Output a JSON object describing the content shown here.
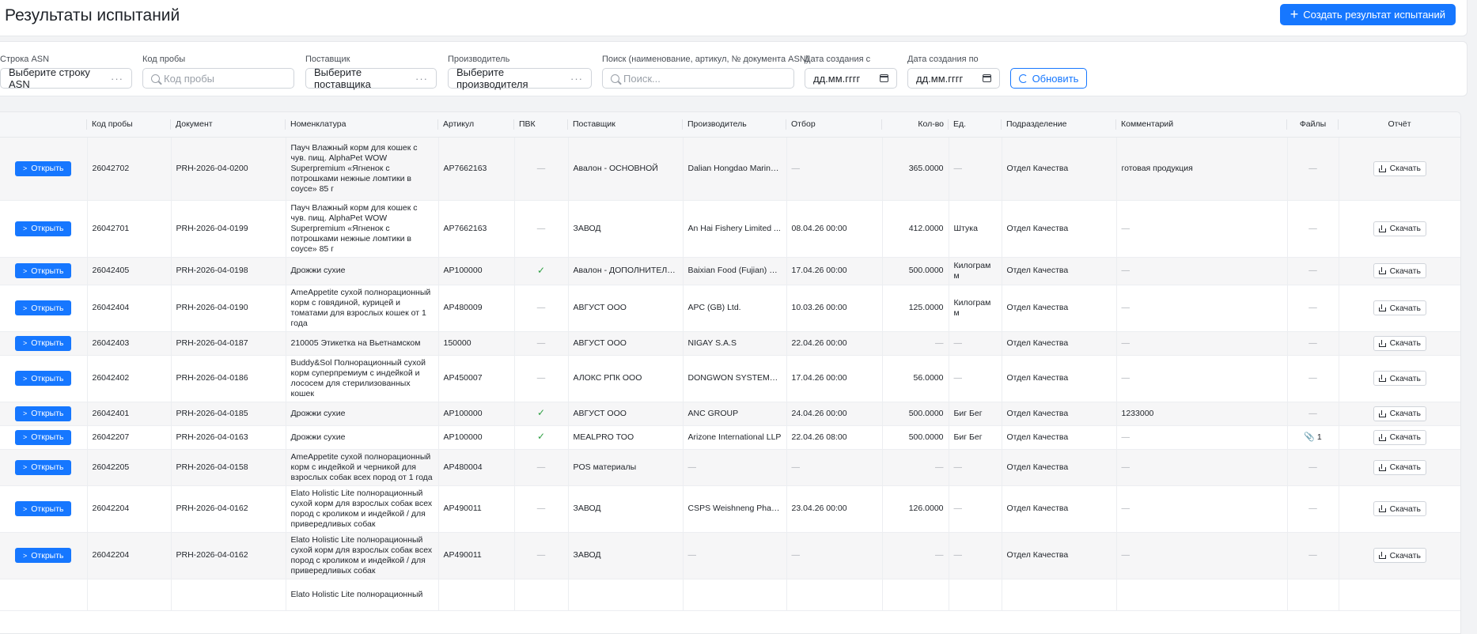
{
  "header": {
    "title": "Результаты испытаний",
    "create_button": "Создать результат испытаний"
  },
  "filters": {
    "asn": {
      "label": "Строка ASN",
      "value": "Выберите строку ASN"
    },
    "sample": {
      "label": "Код пробы",
      "placeholder": "Код пробы"
    },
    "supplier": {
      "label": "Поставщик",
      "value": "Выберите поставщика"
    },
    "manufacturer": {
      "label": "Производитель",
      "value": "Выберите производителя"
    },
    "search": {
      "label": "Поиск (наименование, артикул, № документа ASN)",
      "placeholder": "Поиск..."
    },
    "date_from": {
      "label": "Дата создания с",
      "value": "дд.мм.гггг"
    },
    "date_to": {
      "label": "Дата создания по",
      "value": "дд.мм.гггг"
    },
    "refresh_button": "Обновить"
  },
  "table": {
    "columns": [
      "",
      "Код пробы",
      "Документ",
      "Номенклатура",
      "Артикул",
      "ПВК",
      "Поставщик",
      "Производитель",
      "Отбор",
      "Кол-во",
      "Ед.",
      "Подразделение",
      "Комментарий",
      "Файлы",
      "Отчёт"
    ],
    "open_label": "Открыть",
    "download_label": "Скачать",
    "dash": "—",
    "check": "✓",
    "rows": [
      {
        "code": "26042702",
        "doc": "PRH-2026-04-0200",
        "name": "Пауч Влажный корм для кошек с чув. пищ. AlphaPet WOW Superpremium «Ягненок с потрошками нежные ломтики в соусе» 85 г",
        "article": "AP7662163",
        "pvk": "—",
        "supplier": "Авалон - ОСНОВНОЙ",
        "manufacturer": "Dalian Hongdao Marine...",
        "selection": "—",
        "qty": "365.0000",
        "unit": "—",
        "dept": "Отдел Качества",
        "comment": "готовая продукция",
        "files": "—"
      },
      {
        "code": "26042701",
        "doc": "PRH-2026-04-0199",
        "name": "Пауч Влажный корм для кошек с чув. пищ. AlphaPet WOW Superpremium «Ягненок с потрошками нежные ломтики в соусе» 85 г",
        "article": "AP7662163",
        "pvk": "—",
        "supplier": "ЗАВОД",
        "manufacturer": "An Hai Fishery Limited ...",
        "selection": "08.04.26 00:00",
        "qty": "412.0000",
        "unit": "Штука",
        "dept": "Отдел Качества",
        "comment": "—",
        "files": "—"
      },
      {
        "code": "26042405",
        "doc": "PRH-2026-04-0198",
        "name": "Дрожжи сухие",
        "article": "AP100000",
        "pvk": "✓",
        "supplier": "Авалон - ДОПОЛНИТЕЛЬ...",
        "manufacturer": "Baixian Food (Fujian) Co...",
        "selection": "17.04.26 00:00",
        "qty": "500.0000",
        "unit": "Килограм м",
        "dept": "Отдел Качества",
        "comment": "—",
        "files": "—"
      },
      {
        "code": "26042404",
        "doc": "PRH-2026-04-0190",
        "name": "AmeAppetite сухой полнорационный корм с говядиной, курицей и томатами для взрослых кошек от 1 года",
        "article": "AP480009",
        "pvk": "—",
        "supplier": "АВГУСТ ООО",
        "manufacturer": "APC (GB) Ltd.",
        "selection": "10.03.26 00:00",
        "qty": "125.0000",
        "unit": "Килограм м",
        "dept": "Отдел Качества",
        "comment": "—",
        "files": "—"
      },
      {
        "code": "26042403",
        "doc": "PRH-2026-04-0187",
        "name": "210005 Этикетка на Вьетнамском",
        "article": "150000",
        "pvk": "—",
        "supplier": "АВГУСТ ООО",
        "manufacturer": "NIGAY S.A.S",
        "selection": "22.04.26 00:00",
        "qty": "—",
        "unit": "—",
        "dept": "Отдел Качества",
        "comment": "—",
        "files": "—"
      },
      {
        "code": "26042402",
        "doc": "PRH-2026-04-0186",
        "name": "Buddy&Sol Полнорационный сухой корм суперпремиум с индейкой и лососем для стерилизованных кошек",
        "article": "AP450007",
        "pvk": "—",
        "supplier": "АЛОКС РПК ООО",
        "manufacturer": "DONGWON SYSTEMS C...",
        "selection": "17.04.26 00:00",
        "qty": "56.0000",
        "unit": "—",
        "dept": "Отдел Качества",
        "comment": "—",
        "files": "—"
      },
      {
        "code": "26042401",
        "doc": "PRH-2026-04-0185",
        "name": "Дрожжи сухие",
        "article": "AP100000",
        "pvk": "✓",
        "supplier": "АВГУСТ ООО",
        "manufacturer": "ANC GROUP",
        "selection": "24.04.26 00:00",
        "qty": "500.0000",
        "unit": "Биг Бег",
        "dept": "Отдел Качества",
        "comment": "1233000",
        "files": "—"
      },
      {
        "code": "26042207",
        "doc": "PRH-2026-04-0163",
        "name": "Дрожжи сухие",
        "article": "AP100000",
        "pvk": "✓",
        "supplier": "MEALPRO TOO",
        "manufacturer": "Arizone International LLP",
        "selection": "22.04.26 08:00",
        "qty": "500.0000",
        "unit": "Биг Бег",
        "dept": "Отдел Качества",
        "comment": "—",
        "files": "1"
      },
      {
        "code": "26042205",
        "doc": "PRH-2026-04-0158",
        "name": "AmeAppetite сухой полнорационный корм с индейкой и черникой для взрослых собак всех пород от 1 года",
        "article": "AP480004",
        "pvk": "—",
        "supplier": "POS материалы",
        "manufacturer": "—",
        "selection": "—",
        "qty": "—",
        "unit": "—",
        "dept": "Отдел Качества",
        "comment": "—",
        "files": "—"
      },
      {
        "code": "26042204",
        "doc": "PRH-2026-04-0162",
        "name": "Elato Holistic Lite полнорационный сухой корм для взрослых собак всех пород с кроликом и индейкой / для привередливых собак",
        "article": "AP490011",
        "pvk": "—",
        "supplier": "ЗАВОД",
        "manufacturer": "CSPS Weishneng Pharm...",
        "selection": "23.04.26 00:00",
        "qty": "126.0000",
        "unit": "—",
        "dept": "Отдел Качества",
        "comment": "—",
        "files": "—"
      },
      {
        "code": "26042204",
        "doc": "PRH-2026-04-0162",
        "name": "Elato Holistic Lite полнорационный сухой корм для взрослых собак всех пород с кроликом и индейкой / для привередливых собак",
        "article": "AP490011",
        "pvk": "—",
        "supplier": "ЗАВОД",
        "manufacturer": "—",
        "selection": "—",
        "qty": "—",
        "unit": "—",
        "dept": "Отдел Качества",
        "comment": "—",
        "files": "—"
      },
      {
        "code": "",
        "doc": "",
        "name": "Elato Holistic Lite полнорационный",
        "article": "",
        "pvk": "",
        "supplier": "",
        "manufacturer": "",
        "selection": "",
        "qty": "",
        "unit": "",
        "dept": "",
        "comment": "",
        "files": ""
      }
    ]
  }
}
